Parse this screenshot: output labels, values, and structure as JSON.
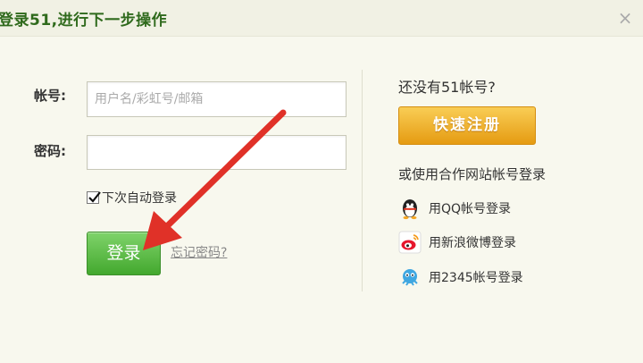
{
  "dialog": {
    "title": "登录51,进行下一步操作",
    "close_icon": "×"
  },
  "form": {
    "account_label": "帐号:",
    "account_placeholder": "用户名/彩虹号/邮箱",
    "account_value": "",
    "password_label": "密码:",
    "password_value": "",
    "remember_label": "下次自动登录",
    "remember_checked": true,
    "login_label": "登录",
    "forgot_label": "忘记密码?"
  },
  "side": {
    "no_account": "还没有51帐号?",
    "register_label": "快速注册",
    "partner_title": "或使用合作网站帐号登录",
    "partners": [
      {
        "label": "用QQ帐号登录",
        "icon": "qq-penguin-icon"
      },
      {
        "label": "用新浪微博登录",
        "icon": "sina-weibo-icon"
      },
      {
        "label": "用2345帐号登录",
        "icon": "2345-icon"
      }
    ]
  },
  "colors": {
    "login_button": "#4cae36",
    "register_button": "#efb22f",
    "title": "#2f6a1c",
    "annotation_arrow": "#e03128"
  }
}
